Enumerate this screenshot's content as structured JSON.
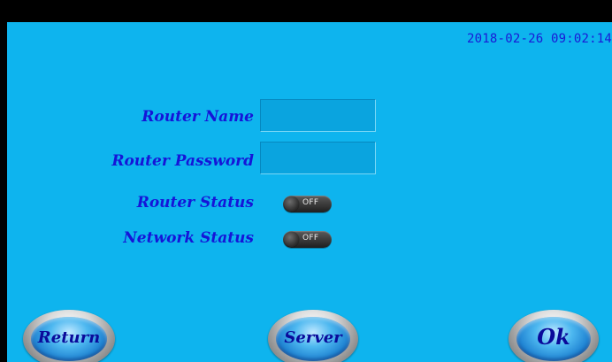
{
  "header": {
    "datetime": "2018-02-26 09:02:14"
  },
  "form": {
    "router_name_label": "Router Name",
    "router_name_value": "",
    "router_password_label": "Router Password",
    "router_password_value": "",
    "router_status_label": "Router Status",
    "router_status_toggle": "OFF",
    "network_status_label": "Network Status",
    "network_status_toggle": "OFF"
  },
  "buttons": {
    "return_label": "Return",
    "server_label": "Server",
    "ok_label": "Ok"
  },
  "colors": {
    "panel_background": "#0eb4ee",
    "label_text": "#1515d8",
    "top_bar": "#000000"
  }
}
